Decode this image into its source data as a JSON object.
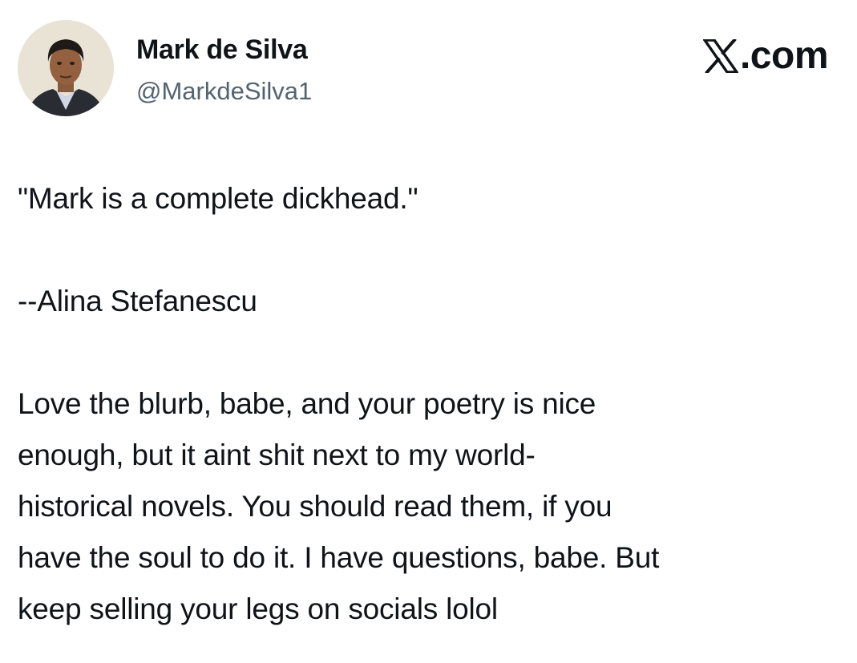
{
  "author": {
    "display_name": "Mark de Silva",
    "handle": "@MarkdeSilva1",
    "avatar_icon": "profile-photo"
  },
  "brand": {
    "icon": "x-logo-icon",
    "text": ".com"
  },
  "tweet": {
    "lines": [
      "\"Mark is a complete dickhead.\"",
      "",
      "--Alina Stefanescu",
      "",
      "Love the blurb, babe, and your poetry is nice",
      "enough, but it aint shit next to my world-",
      "historical novels. You should read them, if you",
      "have the soul to do it. I have questions, babe. But",
      "keep selling your legs on socials lolol"
    ]
  },
  "colors": {
    "text": "#0f1419",
    "handle": "#536471",
    "background": "#ffffff"
  }
}
